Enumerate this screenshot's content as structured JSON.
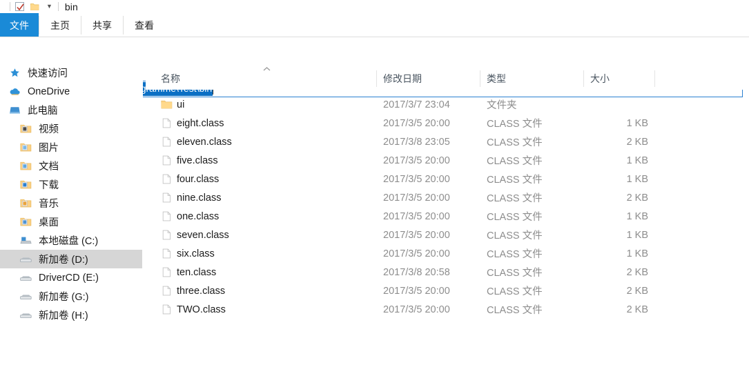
{
  "window": {
    "title": "bin",
    "quick_access": {
      "check_icon": "checkmark-icon",
      "folder_icon": "folder-icon",
      "dropdown_icon": "chevron-down-icon"
    }
  },
  "ribbon": {
    "tabs": [
      {
        "label": "文件",
        "active": true
      },
      {
        "label": "主页",
        "active": false
      },
      {
        "label": "共享",
        "active": false
      },
      {
        "label": "查看",
        "active": false
      }
    ]
  },
  "navbar": {
    "back_icon": "arrow-left-icon",
    "forward_icon": "arrow-right-icon",
    "recent_icon": "chevron-down-icon",
    "up_icon": "arrow-up-icon",
    "address": {
      "folder_icon": "folder-icon",
      "value": "D:\\java programme\\Test\\bin",
      "selected": true
    }
  },
  "columns": {
    "name": "名称",
    "date_modified": "修改日期",
    "type": "类型",
    "size": "大小",
    "sort_icon": "sort-ascending-caret-icon"
  },
  "sidebar": {
    "items": [
      {
        "label": "快速访问",
        "icon": "star-icon",
        "indent": 0,
        "selected": false
      },
      {
        "label": "OneDrive",
        "icon": "cloud-icon",
        "indent": 0,
        "selected": false
      },
      {
        "label": "此电脑",
        "icon": "computer-icon",
        "indent": 0,
        "selected": false
      },
      {
        "label": "视频",
        "icon": "videos-folder-icon",
        "indent": 1,
        "selected": false
      },
      {
        "label": "图片",
        "icon": "pictures-folder-icon",
        "indent": 1,
        "selected": false
      },
      {
        "label": "文档",
        "icon": "documents-folder-icon",
        "indent": 1,
        "selected": false
      },
      {
        "label": "下载",
        "icon": "downloads-folder-icon",
        "indent": 1,
        "selected": false
      },
      {
        "label": "音乐",
        "icon": "music-folder-icon",
        "indent": 1,
        "selected": false
      },
      {
        "label": "桌面",
        "icon": "desktop-folder-icon",
        "indent": 1,
        "selected": false
      },
      {
        "label": "本地磁盘 (C:)",
        "icon": "system-drive-icon",
        "indent": 1,
        "selected": false
      },
      {
        "label": "新加卷 (D:)",
        "icon": "drive-icon",
        "indent": 1,
        "selected": true
      },
      {
        "label": "DriverCD (E:)",
        "icon": "drive-icon",
        "indent": 1,
        "selected": false
      },
      {
        "label": "新加卷 (G:)",
        "icon": "drive-icon",
        "indent": 1,
        "selected": false
      },
      {
        "label": "新加卷 (H:)",
        "icon": "drive-icon",
        "indent": 1,
        "selected": false
      }
    ]
  },
  "files": [
    {
      "name": "ui",
      "icon": "folder-icon",
      "date": "2017/3/7 23:04",
      "type": "文件夹",
      "size": ""
    },
    {
      "name": "eight.class",
      "icon": "file-icon",
      "date": "2017/3/5 20:00",
      "type": "CLASS 文件",
      "size": "1 KB"
    },
    {
      "name": "eleven.class",
      "icon": "file-icon",
      "date": "2017/3/8 23:05",
      "type": "CLASS 文件",
      "size": "2 KB"
    },
    {
      "name": "five.class",
      "icon": "file-icon",
      "date": "2017/3/5 20:00",
      "type": "CLASS 文件",
      "size": "1 KB"
    },
    {
      "name": "four.class",
      "icon": "file-icon",
      "date": "2017/3/5 20:00",
      "type": "CLASS 文件",
      "size": "1 KB"
    },
    {
      "name": "nine.class",
      "icon": "file-icon",
      "date": "2017/3/5 20:00",
      "type": "CLASS 文件",
      "size": "2 KB"
    },
    {
      "name": "one.class",
      "icon": "file-icon",
      "date": "2017/3/5 20:00",
      "type": "CLASS 文件",
      "size": "1 KB"
    },
    {
      "name": "seven.class",
      "icon": "file-icon",
      "date": "2017/3/5 20:00",
      "type": "CLASS 文件",
      "size": "1 KB"
    },
    {
      "name": "six.class",
      "icon": "file-icon",
      "date": "2017/3/5 20:00",
      "type": "CLASS 文件",
      "size": "1 KB"
    },
    {
      "name": "ten.class",
      "icon": "file-icon",
      "date": "2017/3/8 20:58",
      "type": "CLASS 文件",
      "size": "2 KB"
    },
    {
      "name": "three.class",
      "icon": "file-icon",
      "date": "2017/3/5 20:00",
      "type": "CLASS 文件",
      "size": "2 KB"
    },
    {
      "name": "TWO.class",
      "icon": "file-icon",
      "date": "2017/3/5 20:00",
      "type": "CLASS 文件",
      "size": "2 KB"
    }
  ],
  "colors": {
    "accent": "#1a8ad7",
    "selection": "#0b6fc4",
    "sidebar_selected": "#d6d6d6",
    "folder_yellow": "#ffca5f",
    "muted_text": "#8d8d8d"
  }
}
